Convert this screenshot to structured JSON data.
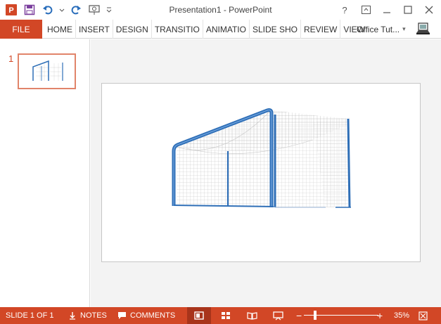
{
  "window": {
    "title": "Presentation1 - PowerPoint",
    "help_label": "?",
    "ribbon_display_icon": "ribbon-display-options-icon",
    "minimize_icon": "minimize-icon",
    "maximize_icon": "maximize-icon",
    "close_icon": "close-icon"
  },
  "quick_access": {
    "app_icon": "powerpoint-icon",
    "items": [
      "save-icon",
      "undo-icon",
      "undo-dropdown-icon",
      "redo-icon",
      "start-from-beginning-icon",
      "customize-qat-icon"
    ]
  },
  "ribbon": {
    "file_label": "FILE",
    "tabs": [
      "HOME",
      "INSERT",
      "DESIGN",
      "TRANSITIO",
      "ANIMATIO",
      "SLIDE SHO",
      "REVIEW",
      "VIEW"
    ],
    "account_name": "Office Tut...",
    "account_dropdown": "▾"
  },
  "thumbnails": [
    {
      "number": "1",
      "selected": true,
      "content": "soccer-goal-image"
    }
  ],
  "slide": {
    "content": "soccer-goal-image"
  },
  "status": {
    "slide_info": "SLIDE 1 OF 1",
    "notes_label": "NOTES",
    "comments_label": "COMMENTS",
    "views": [
      "normal-view-icon",
      "slide-sorter-icon",
      "reading-view-icon",
      "slide-show-icon"
    ],
    "active_view": "normal-view-icon",
    "zoom_minus": "−",
    "zoom_plus": "+",
    "zoom_level": "35%",
    "zoom_fraction": 0.35,
    "fit_icon": "fit-slide-to-window-icon"
  },
  "colors": {
    "accent": "#d24726",
    "accent_dark": "#a8341b",
    "goal_frame": "#2f6fb7",
    "net": "#b5b5b5"
  }
}
